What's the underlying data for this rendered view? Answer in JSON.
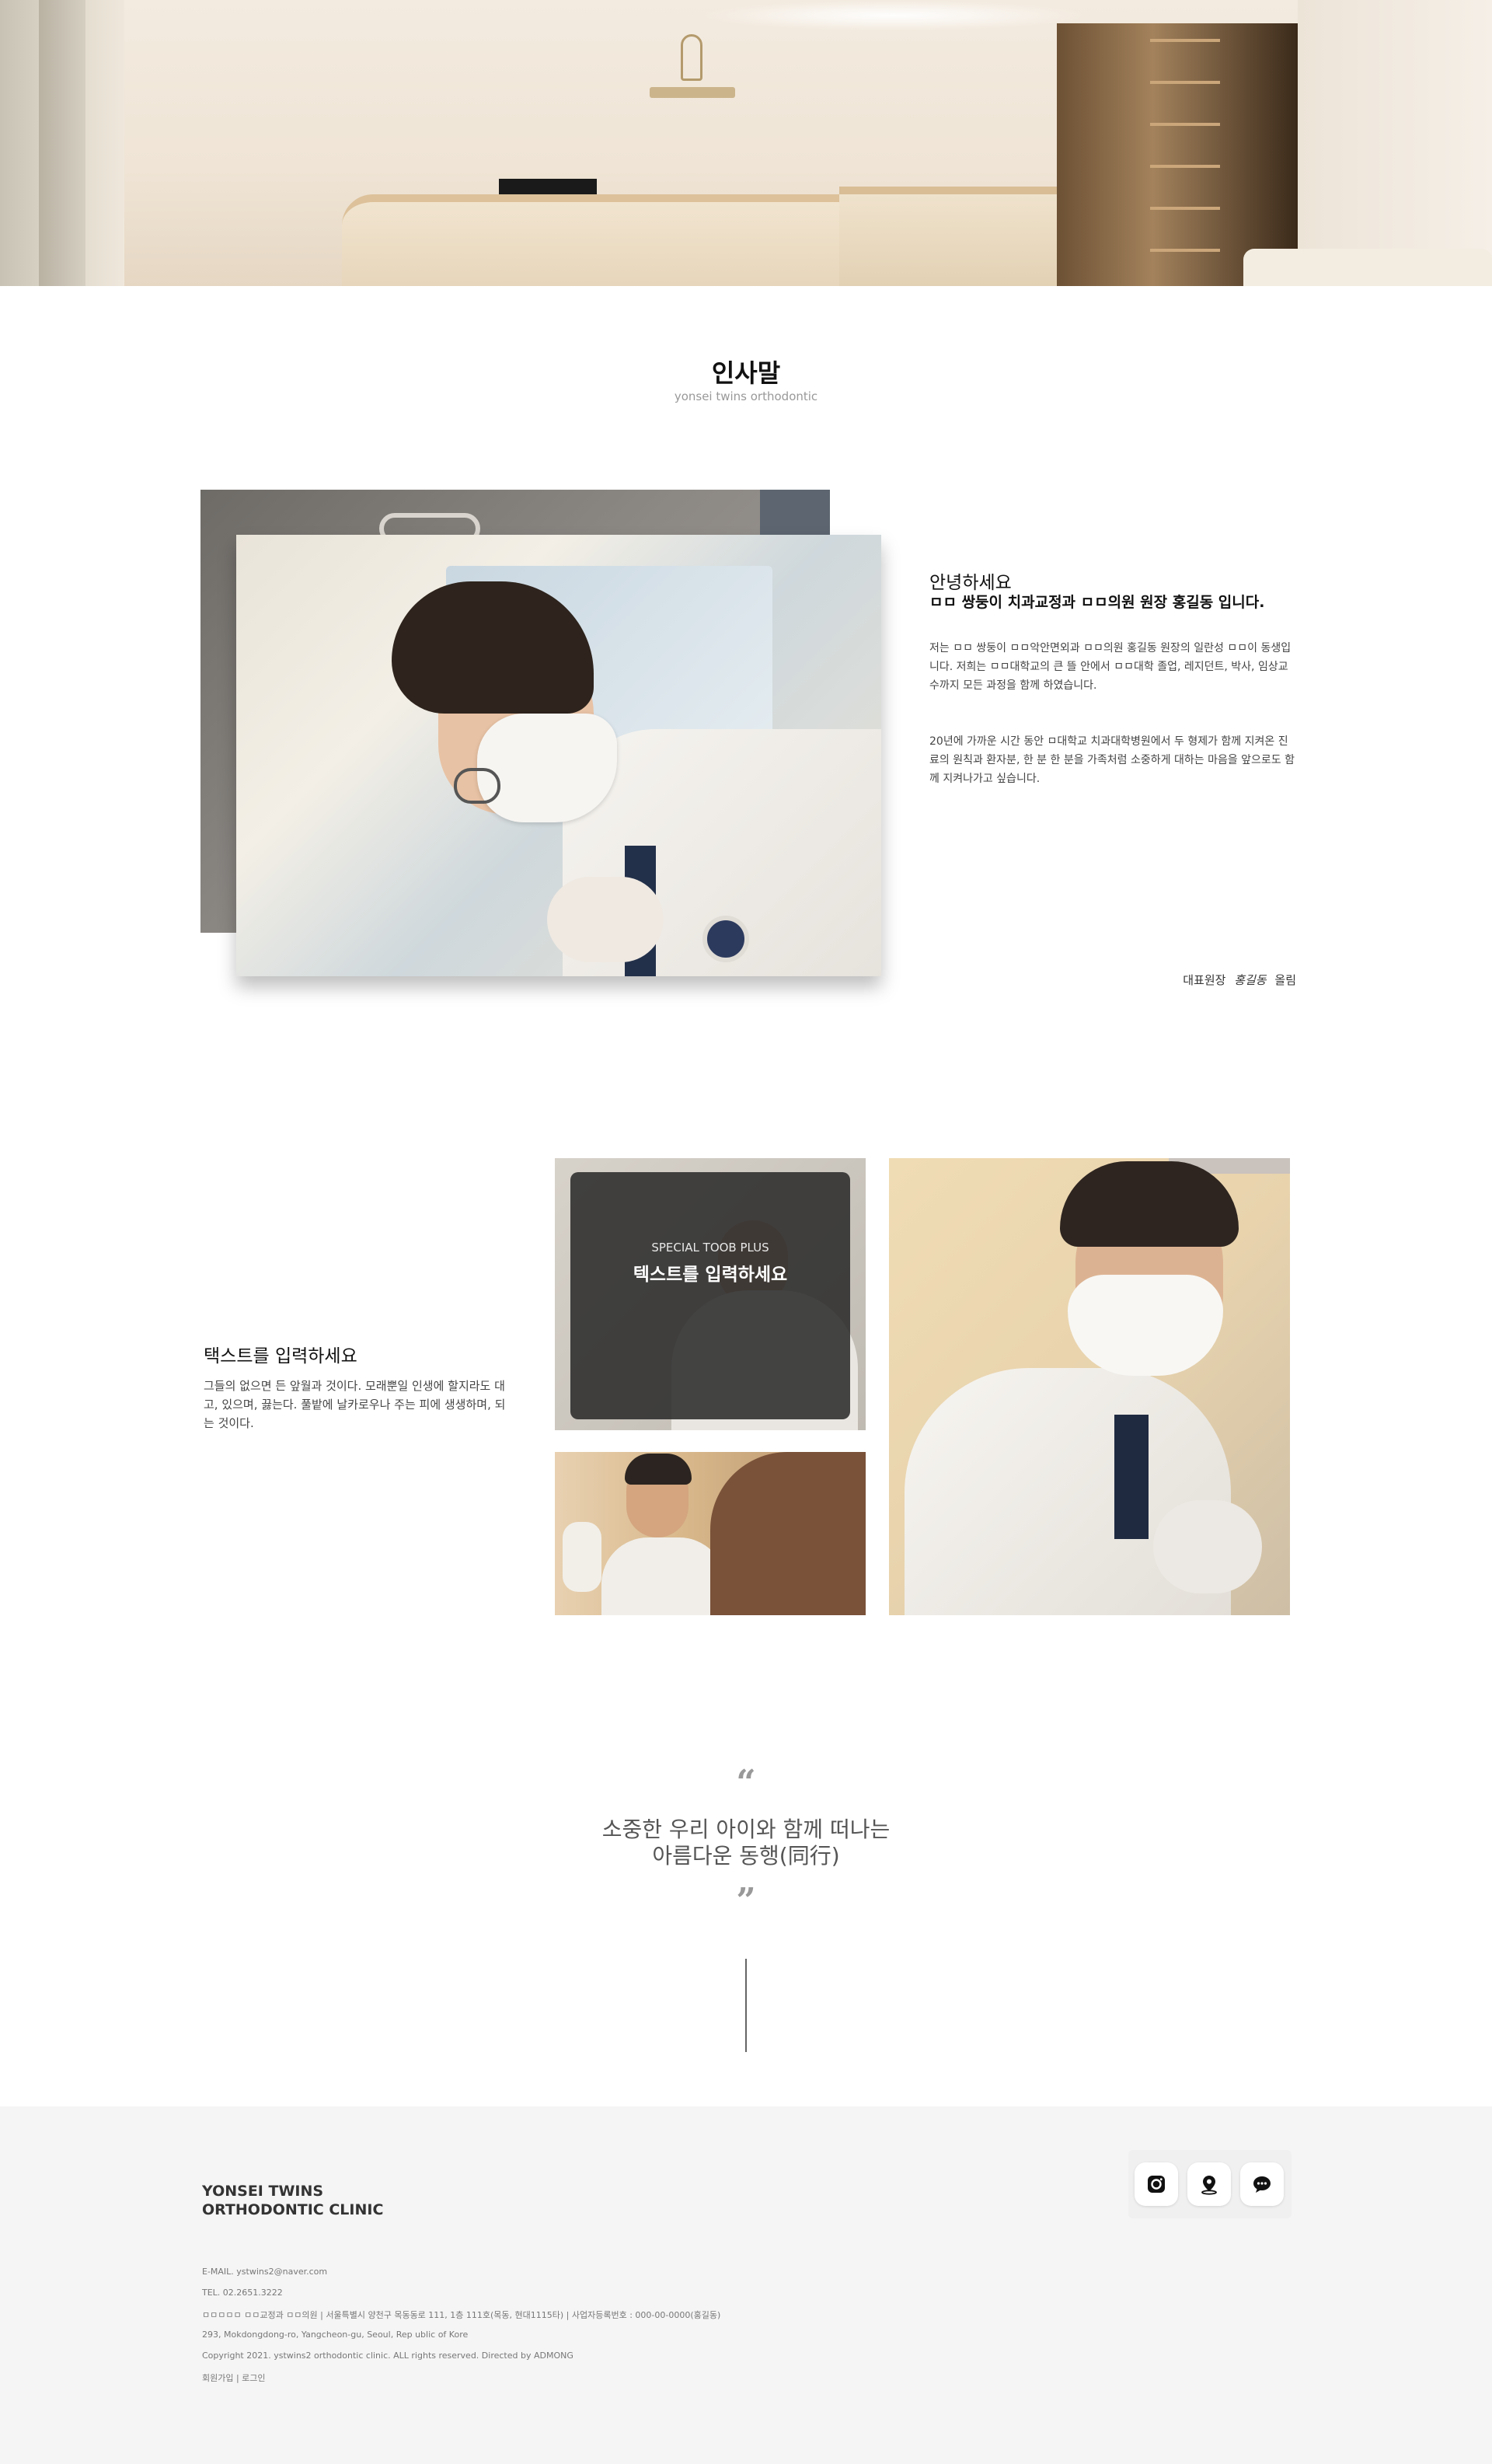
{
  "greeting": {
    "section_title": "인사말",
    "section_subtitle": "yonsei twins orthodontic",
    "hello": "안녕하세요",
    "headline": "ㅁㅁ 쌍둥이 치과교정과 ㅁㅁ의원 원장 홍길동 입니다.",
    "paragraph1": "저는 ㅁㅁ 쌍둥이 ㅁㅁ악안면외과 ㅁㅁ의원 홍길동 원장의 일란성 ㅁㅁ이 동생입니다. 저희는 ㅁㅁ대학교의 큰 뜰 안에서 ㅁㅁ대학 졸업, 레지던트, 박사, 임상교수까지 모든 과정을 함께 하였습니다.",
    "paragraph2": "20년에 가까운 시간 동안 ㅁ대학교 치과대학병원에서 두 형제가 함께 지켜온 진료의 원칙과 환자분, 한 분 한 분을 가족처럼 소중하게 대하는 마음을 앞으로도 함께 지켜나가고 싶습니다.",
    "sign_prefix": "대표원장",
    "sign_name": "홍길동",
    "sign_suffix": "올림"
  },
  "feature": {
    "title": "택스트를 입력하세요",
    "body": "그들의 없으면 든 앞월과 것이다. 모래뿐일 인생에 할지라도 대고, 있으며, 끓는다. 풀밭에 날카로우나 주는 피에 생생하며, 되는 것이다.",
    "card_subtitle": "SPECIAL TOOB PLUS",
    "card_title": "텍스트를 입력하세요"
  },
  "quote": {
    "open_mark": "“",
    "line1": "소중한 우리 아이와 함께 떠나는",
    "line2": "아름다운 동행(同行)",
    "close_mark": "”"
  },
  "footer": {
    "brand_line1": "YONSEI TWINS",
    "brand_line2": "ORTHODONTIC CLINIC",
    "email": "E-MAIL. ystwins2@naver.com",
    "tel": "TEL. 02.2651.3222",
    "address_kr": "ㅁㅁㅁㅁㅁ ㅁㅁ교정과 ㅁㅁ의원  |  서울특별시 양천구 목동동로 111, 1층 111호(목동, 현대1115타)  |  사업자등록번호 : 000-00-0000(홍길동)",
    "address_en": "293, Mokdongdong-ro, Yangcheon-gu, Seoul, Rep ublic of Kore",
    "copyright": "Copyright 2021. ystwins2 orthodontic clinic. ALL rights reserved. Directed by ADMONG",
    "links": "회원가입  |  로그인",
    "icons": [
      "instagram-icon",
      "map-pin-icon",
      "chat-icon"
    ]
  }
}
